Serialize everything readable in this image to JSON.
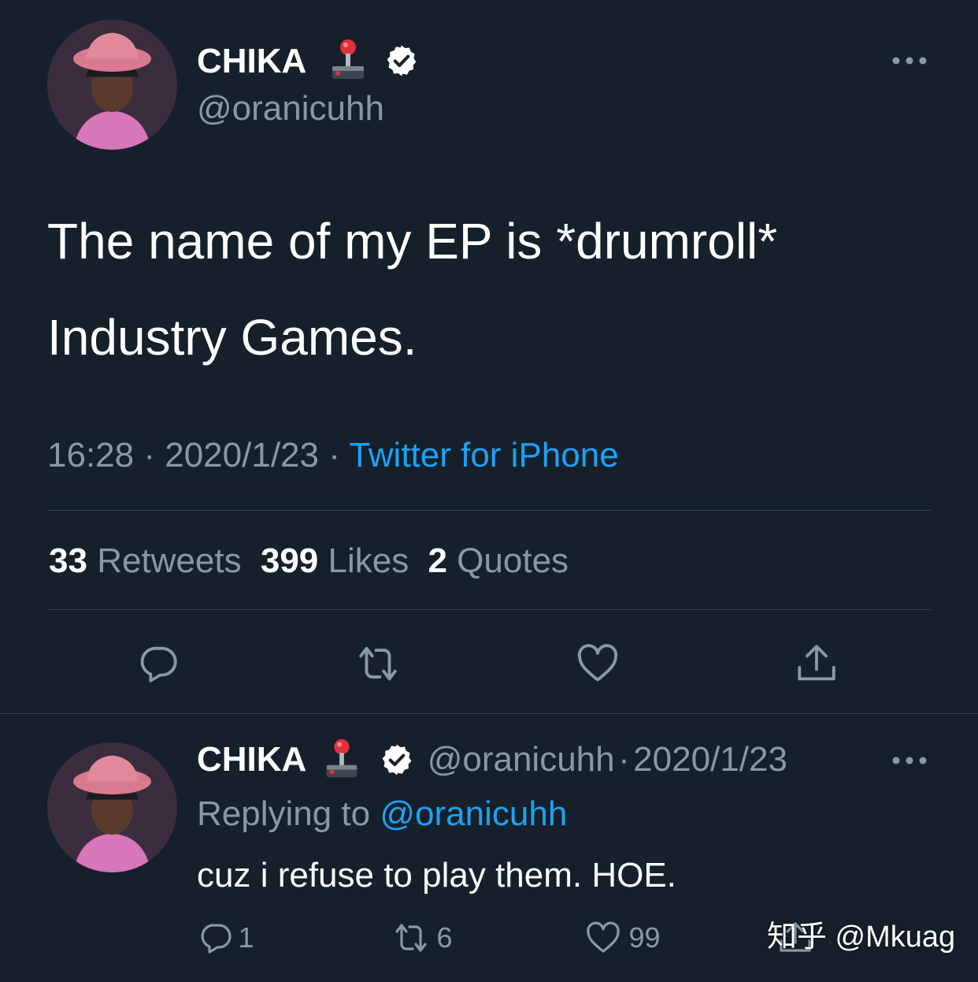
{
  "main_tweet": {
    "display_name": "CHIKA",
    "handle": "@oranicuhh",
    "body_line1": "The name of my EP is *drumroll*",
    "body_line2": "Industry Games.",
    "time": "16:28",
    "date": "2020/1/23",
    "source": "Twitter for iPhone",
    "sep": "·",
    "stats": {
      "retweets_count": "33",
      "retweets_label": "Retweets",
      "likes_count": "399",
      "likes_label": "Likes",
      "quotes_count": "2",
      "quotes_label": "Quotes"
    }
  },
  "reply_tweet": {
    "display_name": "CHIKA",
    "handle": "@oranicuhh",
    "sep": "·",
    "date": "2020/1/23",
    "replying_prefix": "Replying to",
    "replying_handle": "@oranicuhh",
    "body": "cuz i refuse to play them. HOE.",
    "reply_count": "1",
    "retweet_count": "6",
    "like_count": "99"
  },
  "watermark": "知乎 @Mkuag",
  "colors": {
    "background": "#15202b",
    "muted": "#8899a6",
    "link": "#1da1f2",
    "divider": "#38444d"
  },
  "icons": [
    "joystick-icon",
    "verified-badge-icon",
    "more-icon",
    "reply-icon",
    "retweet-icon",
    "like-icon",
    "share-icon"
  ]
}
